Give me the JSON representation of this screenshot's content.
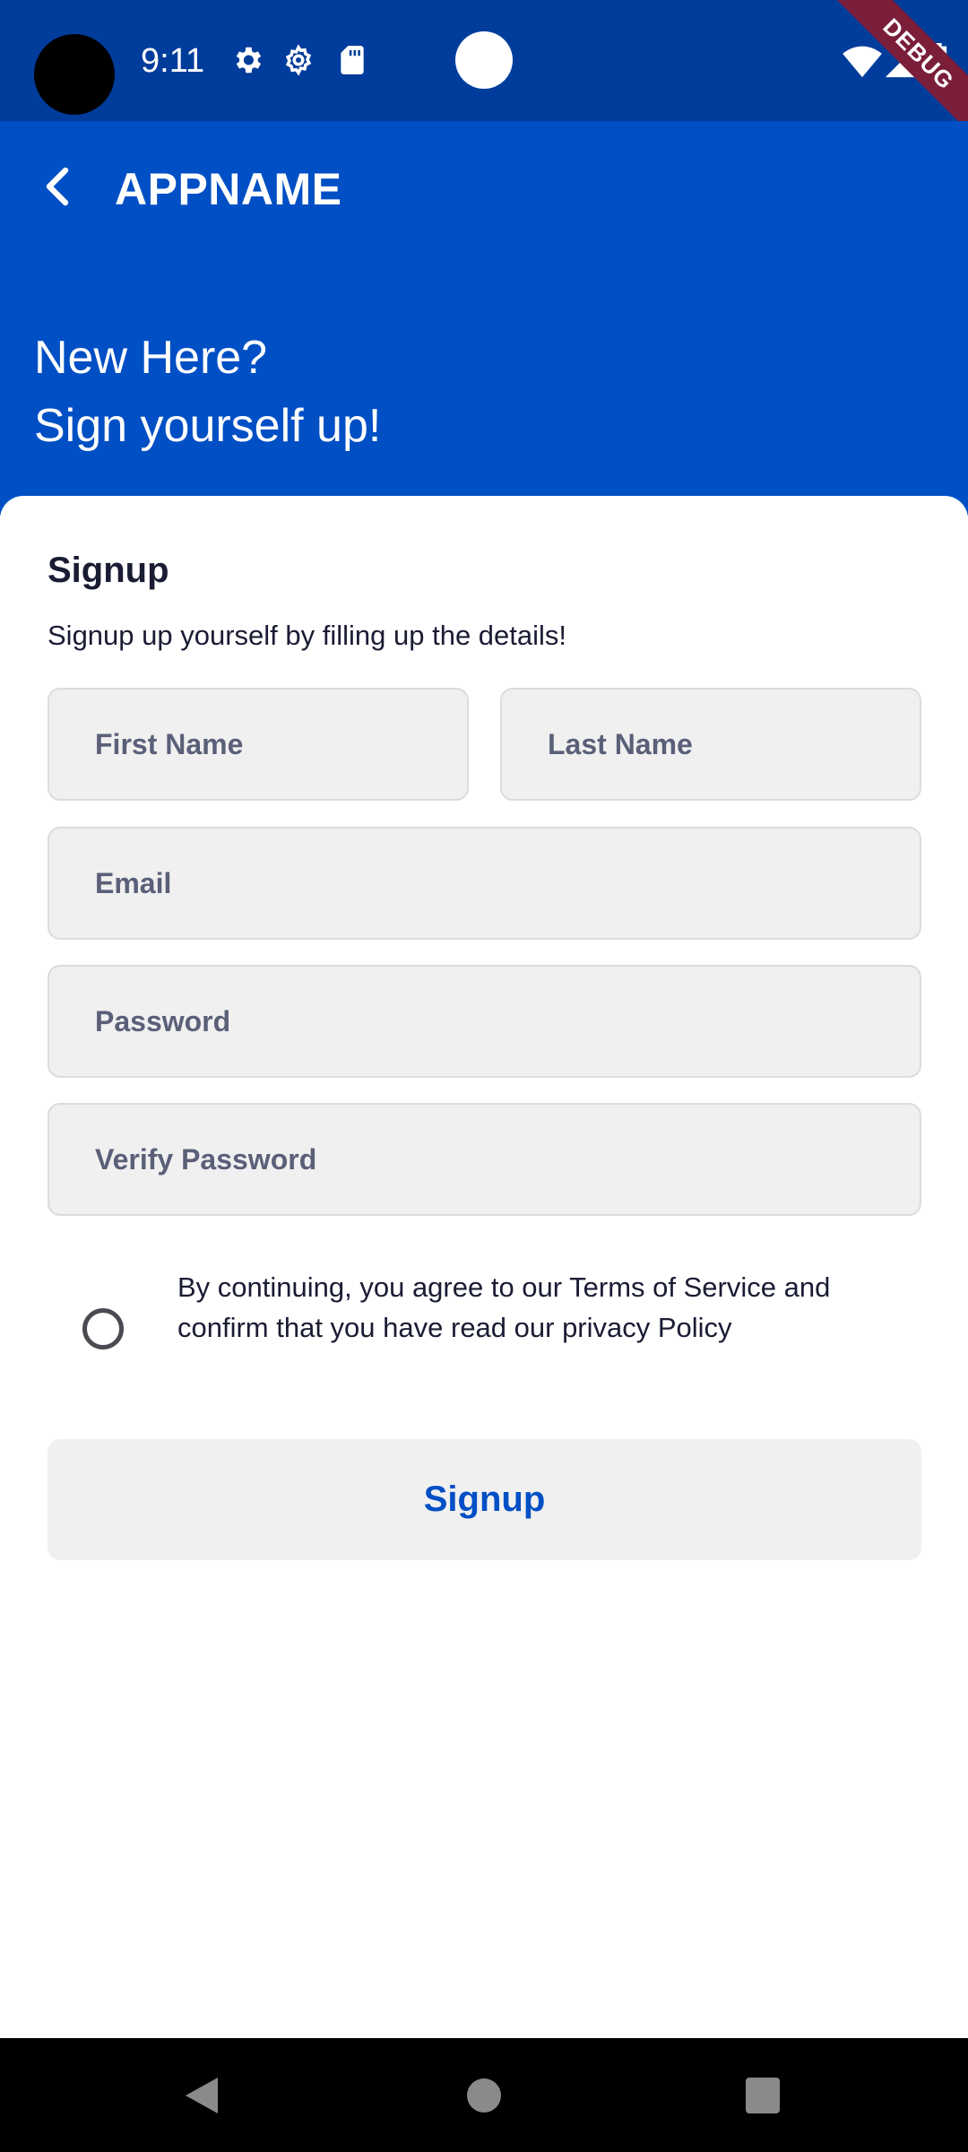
{
  "status_bar": {
    "time": "9:11",
    "icons": [
      "gear-icon",
      "settings-icon",
      "sd-card-icon",
      "wifi-icon",
      "signal-icon",
      "battery-icon"
    ],
    "debug_label": "DEBUG"
  },
  "app_bar": {
    "title": "APPNAME",
    "back_icon": "chevron-left-icon"
  },
  "hero": {
    "line1": "New Here?",
    "line2": "Sign yourself up!"
  },
  "form": {
    "title": "Signup",
    "subtitle": "Signup up yourself by filling up the details!",
    "first_name_placeholder": "First Name",
    "last_name_placeholder": "Last Name",
    "email_placeholder": "Email",
    "password_placeholder": "Password",
    "verify_password_placeholder": "Verify Password",
    "terms_text": "By continuing, you agree to our Terms of Service and confirm that you have read our privacy Policy",
    "terms_checked": false,
    "submit_label": "Signup"
  },
  "nav_bar": {
    "icons": [
      "back-triangle-icon",
      "home-circle-icon",
      "recents-square-icon"
    ]
  },
  "colors": {
    "status_bar": "#003c9b",
    "primary": "#004fc5",
    "field_bg": "#f0f0f0",
    "text_dark": "#1a1c33",
    "placeholder": "#5a6078"
  }
}
